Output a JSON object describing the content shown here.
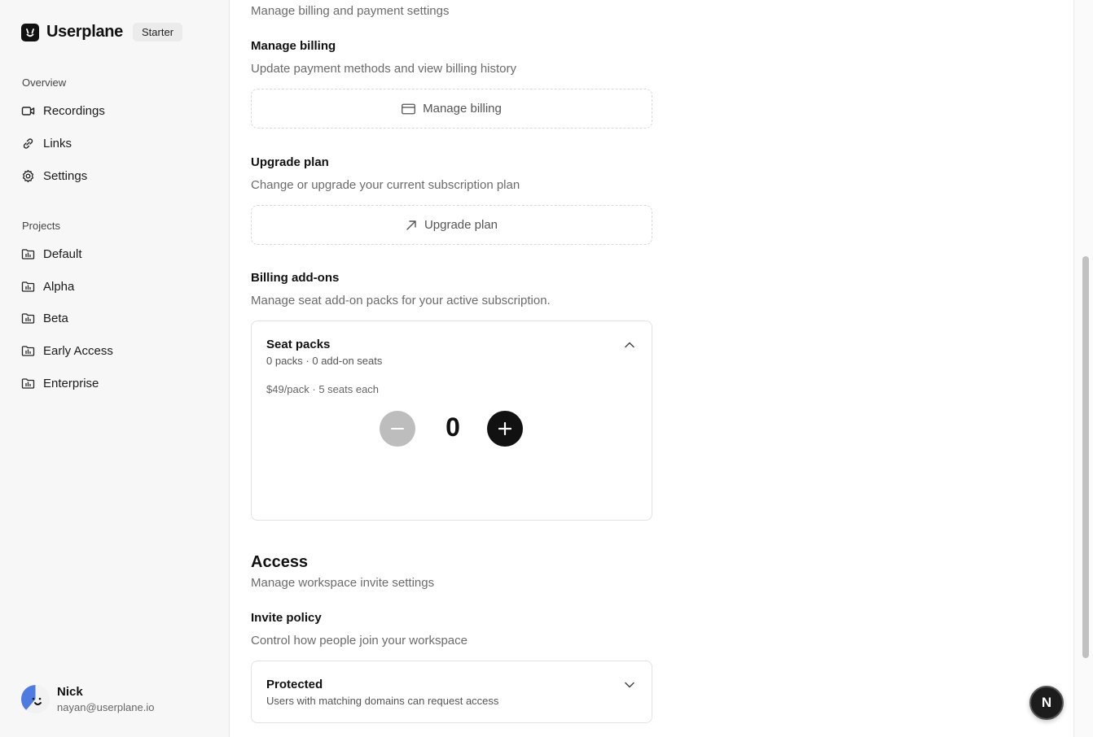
{
  "brand": {
    "name": "Userplane",
    "plan": "Starter"
  },
  "sidebar": {
    "overview_label": "Overview",
    "overview_items": [
      {
        "label": "Recordings",
        "icon": "video-icon"
      },
      {
        "label": "Links",
        "icon": "link-icon"
      },
      {
        "label": "Settings",
        "icon": "gear-icon"
      }
    ],
    "projects_label": "Projects",
    "projects": [
      {
        "label": "Default",
        "icon": "folder-chart-icon"
      },
      {
        "label": "Alpha",
        "icon": "folder-chart-icon"
      },
      {
        "label": "Beta",
        "icon": "folder-chart-icon"
      },
      {
        "label": "Early Access",
        "icon": "folder-chart-icon"
      },
      {
        "label": "Enterprise",
        "icon": "folder-chart-icon"
      }
    ]
  },
  "user": {
    "name": "Nick",
    "email": "nayan@userplane.io"
  },
  "billing": {
    "section_desc": "Manage billing and payment settings",
    "manage": {
      "title": "Manage billing",
      "desc": "Update payment methods and view billing history",
      "button": "Manage billing"
    },
    "upgrade": {
      "title": "Upgrade plan",
      "desc": "Change or upgrade your current subscription plan",
      "button": "Upgrade plan"
    },
    "addons": {
      "title": "Billing add-ons",
      "desc": "Manage seat add-on packs for your active subscription.",
      "seat_packs": {
        "title": "Seat packs",
        "summary": "0 packs · 0 add-on seats",
        "price": "$49/pack · 5 seats each",
        "count": "0"
      }
    }
  },
  "access": {
    "title": "Access",
    "desc": "Manage workspace invite settings",
    "invite_policy": {
      "title": "Invite policy",
      "desc": "Control how people join your workspace",
      "selected": "Protected",
      "selected_desc": "Users with matching domains can request access"
    }
  },
  "fab": {
    "label": "N"
  }
}
